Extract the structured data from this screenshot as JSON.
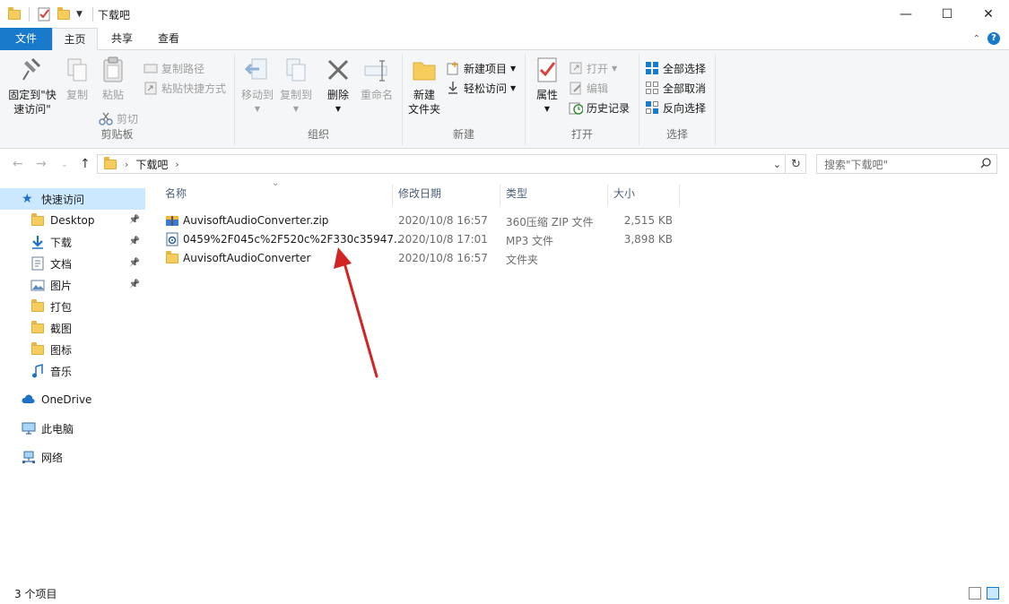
{
  "window": {
    "title": "下载吧",
    "minimize_glyph": "—",
    "maximize_glyph": "☐",
    "close_glyph": "✕"
  },
  "ribbon_tabs": {
    "file": "文件",
    "home": "主页",
    "share": "共享",
    "view": "查看"
  },
  "ribbon": {
    "clipboard": {
      "label": "剪贴板",
      "pin": "固定到\"快速访问\"",
      "copy": "复制",
      "paste": "粘贴",
      "copy_path": "复制路径",
      "paste_shortcut": "粘贴快捷方式",
      "cut": "剪切"
    },
    "organize": {
      "label": "组织",
      "move_to": "移动到",
      "copy_to": "复制到",
      "delete": "删除",
      "rename": "重命名"
    },
    "new": {
      "label": "新建",
      "new_folder": "新建\n文件夹",
      "new_item": "新建项目",
      "easy_access": "轻松访问"
    },
    "open": {
      "label": "打开",
      "properties": "属性",
      "open": "打开",
      "edit": "编辑",
      "history": "历史记录"
    },
    "select": {
      "label": "选择",
      "select_all": "全部选择",
      "select_none": "全部取消",
      "invert": "反向选择"
    }
  },
  "address": {
    "crumb": "下载吧",
    "search_placeholder": "搜索\"下载吧\""
  },
  "nav_pane": {
    "quick_access": "快速访问",
    "items": [
      {
        "label": "Desktop",
        "icon": "folder-icon",
        "pinned": true
      },
      {
        "label": "下载",
        "icon": "download-icon",
        "pinned": true
      },
      {
        "label": "文档",
        "icon": "document-icon",
        "pinned": true
      },
      {
        "label": "图片",
        "icon": "pictures-icon",
        "pinned": true
      },
      {
        "label": "打包",
        "icon": "folder-icon",
        "pinned": false
      },
      {
        "label": "截图",
        "icon": "folder-icon",
        "pinned": false
      },
      {
        "label": "图标",
        "icon": "folder-icon",
        "pinned": false
      },
      {
        "label": "音乐",
        "icon": "music-icon",
        "pinned": false
      }
    ],
    "onedrive": "OneDrive",
    "this_pc": "此电脑",
    "network": "网络"
  },
  "columns": {
    "name": "名称",
    "modified": "修改日期",
    "type": "类型",
    "size": "大小"
  },
  "files": [
    {
      "name": "AuvisoftAudioConverter.zip",
      "modified": "2020/10/8 16:57",
      "type": "360压缩 ZIP 文件",
      "size": "2,515 KB",
      "icon": "zip-icon"
    },
    {
      "name": "0459%2F045c%2F520c%2F330c35947...",
      "modified": "2020/10/8 17:01",
      "type": "MP3 文件",
      "size": "3,898 KB",
      "icon": "mp3-icon"
    },
    {
      "name": "AuvisoftAudioConverter",
      "modified": "2020/10/8 16:57",
      "type": "文件夹",
      "size": "",
      "icon": "folder-icon"
    }
  ],
  "status": {
    "count": "3 个项目"
  },
  "colors": {
    "accent": "#1979ca",
    "selected_nav": "#cce8ff",
    "annotation_arrow": "#d32424"
  }
}
